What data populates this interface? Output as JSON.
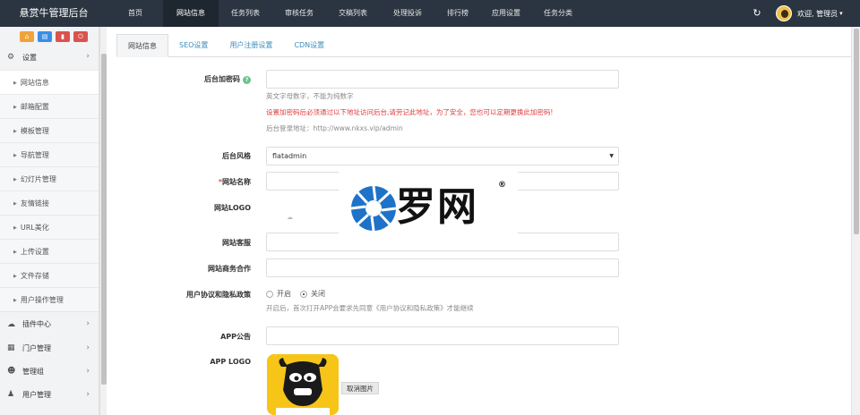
{
  "brand": "悬赏牛管理后台",
  "nav": [
    "首页",
    "网站信息",
    "任务列表",
    "审核任务",
    "交稿列表",
    "处理投诉",
    "排行榜",
    "应用设置",
    "任务分类"
  ],
  "nav_active": "网站信息",
  "user": {
    "name": "欢迎, 管理员"
  },
  "sidebar": {
    "settings": "设置",
    "items": [
      "网站信息",
      "邮箱配置",
      "模板管理",
      "导航管理",
      "幻灯片管理",
      "友情链接",
      "URL美化",
      "上传设置",
      "文件存储",
      "用户操作管理"
    ],
    "groups": [
      "插件中心",
      "门户管理",
      "管理组",
      "用户管理"
    ]
  },
  "tabs": [
    "网站信息",
    "SEO设置",
    "用户注册设置",
    "CDN设置"
  ],
  "form": {
    "admin_code_label": "后台加密码",
    "hint_alnum": "英文字母数字，不能为纯数字",
    "hint_warning": "设置加密码后必须通过以下地址访问后台,请劳记此地址，为了安全，您也可以定期更换此加密码!",
    "hint_login_url": "后台登录地址：http://www.nkxs.vip/admin",
    "style_label": "后台风格",
    "style_value": "flatadmin",
    "site_name_label": "网站名称",
    "logo_label": "网站LOGO",
    "service_label": "网站客服",
    "biz_label": "网站商务合作",
    "agreement_label": "用户协议和隐私政策",
    "agreement_on": "开启",
    "agreement_off": "关闭",
    "agreement_selected": "关闭",
    "agreement_hint": "开启后，首次打开APP会要求先同意《用户协议和隐私政策》才能继续",
    "app_notice_label": "APP公告",
    "app_logo_label": "APP LOGO",
    "cancel_image": "取消图片"
  },
  "watermark": {
    "text": "罗网",
    "reg": "®"
  },
  "colors": {
    "topbar": "#2b3541",
    "link": "#3c8dbc",
    "warning": "#e03b3b"
  }
}
